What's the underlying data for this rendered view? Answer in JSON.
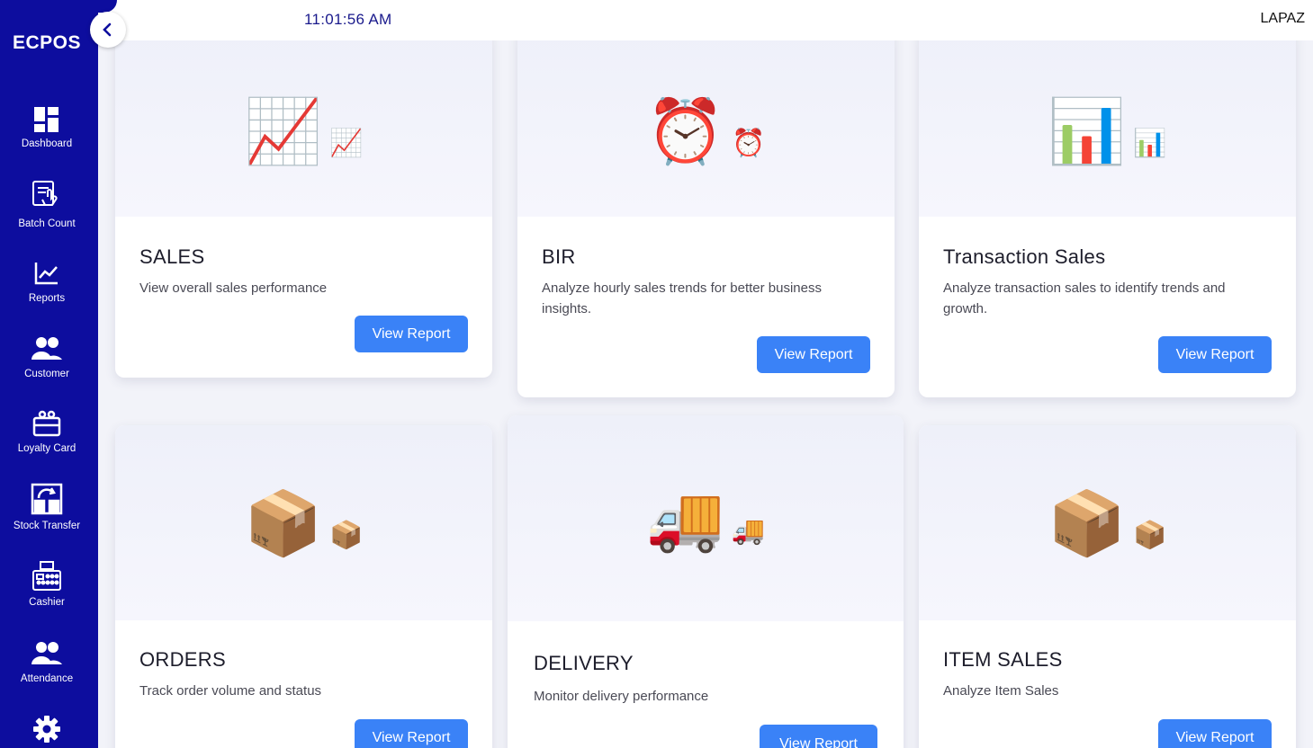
{
  "sidebar": {
    "brand": "ECPOS",
    "items": [
      {
        "label": "Dashboard",
        "icon": "dashboard-icon"
      },
      {
        "label": "Batch Count",
        "icon": "batch-count-icon"
      },
      {
        "label": "Reports",
        "icon": "reports-icon"
      },
      {
        "label": "Customer",
        "icon": "customer-icon"
      },
      {
        "label": "Loyalty Card",
        "icon": "loyalty-card-icon"
      },
      {
        "label": "Stock Transfer",
        "icon": "stock-transfer-icon"
      },
      {
        "label": "Cashier",
        "icon": "cashier-icon"
      },
      {
        "label": "Attendance",
        "icon": "attendance-icon"
      },
      {
        "label": "",
        "icon": "settings-icon"
      }
    ],
    "collapse_icon": "chevron-left-icon"
  },
  "header": {
    "time": "11:01:56 AM",
    "branch": "LAPAZ"
  },
  "cards": [
    {
      "title": "SALES",
      "description": "View overall sales performance",
      "button": "View Report",
      "icon": "chart-increasing-icon",
      "emoji": "📈"
    },
    {
      "title": "BIR",
      "description": "Analyze hourly sales trends for better business insights.",
      "button": "View Report",
      "icon": "alarm-clock-icon",
      "emoji": "⏰"
    },
    {
      "title": "Transaction Sales",
      "description": "Analyze transaction sales to identify trends and growth.",
      "button": "View Report",
      "icon": "bar-chart-icon",
      "emoji": "📊"
    },
    {
      "title": "ORDERS",
      "description": "Track order volume and status",
      "button": "View Report",
      "icon": "package-icon",
      "emoji": "📦"
    },
    {
      "title": "DELIVERY",
      "description": "Monitor delivery performance",
      "button": "View Report",
      "icon": "delivery-truck-icon",
      "emoji": "🚚"
    },
    {
      "title": "ITEM SALES",
      "description": "Analyze Item Sales",
      "button": "View Report",
      "icon": "package-icon",
      "emoji": "📦"
    }
  ],
  "colors": {
    "sidebar": "#0d0d9e",
    "accent": "#3a82f7",
    "clock": "#1a1a8c"
  }
}
